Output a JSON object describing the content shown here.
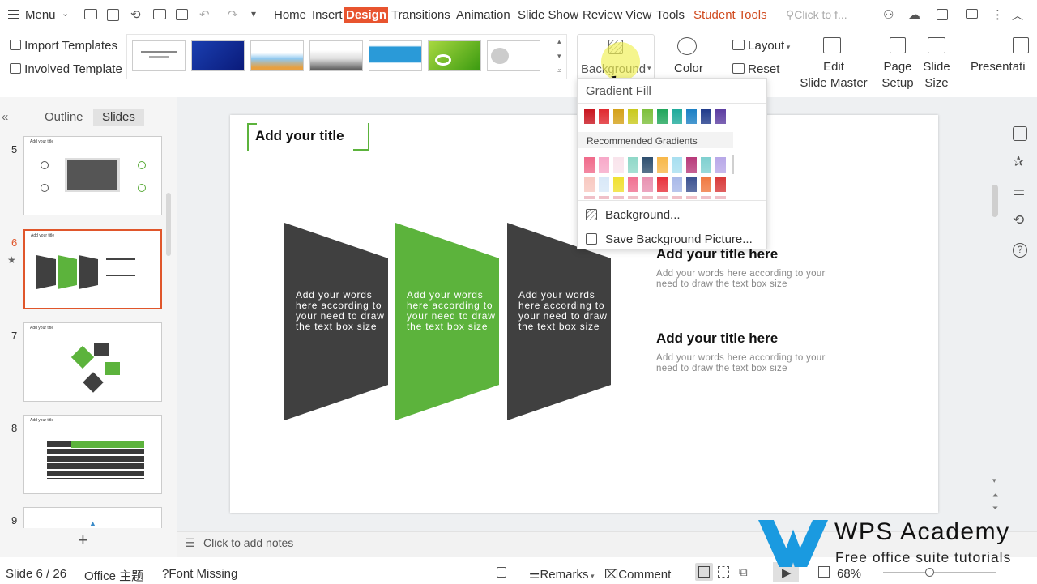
{
  "menubar": {
    "menu_label": "Menu",
    "tabs": [
      "Home",
      "Insert",
      "Design",
      "Transitions",
      "Animation",
      "Slide Show",
      "Review",
      "View",
      "Tools",
      "Student Tools"
    ],
    "search_placeholder": "Click to f..."
  },
  "ribbon": {
    "import_templates": "Import Templates",
    "involved_template": "Involved Template",
    "background": "Background",
    "color": "Color",
    "layout": "Layout",
    "reset": "Reset",
    "edit_slide_master_1": "Edit",
    "edit_slide_master_2": "Slide Master",
    "page_setup_1": "Page",
    "page_setup_2": "Setup",
    "slide_size_1": "Slide",
    "slide_size_2": "Size",
    "presentation": "Presentati"
  },
  "sidebar": {
    "tab_outline": "Outline",
    "tab_slides": "Slides",
    "slide_numbers": [
      "5",
      "6",
      "7",
      "8",
      "9"
    ],
    "thumb_title": "Add your title"
  },
  "slide": {
    "title": "Add your title",
    "block1": "Add your words here according to your need to draw the text box size",
    "block2": "Add your words here according to your need to draw the text box size",
    "block3": "Add your words here according to your need to draw the text box size",
    "item1_title": "Add your title here",
    "item1_text": "Add your words here according to your need to draw the text box size",
    "item2_title": "Add your title here",
    "item2_text": "Add your words here according to your need to draw the text box size"
  },
  "notes_placeholder": "Click to add notes",
  "dropdown": {
    "gradient_fill": "Gradient Fill",
    "recommended": "Recommended Gradients",
    "background_item": "Background...",
    "save_picture": "Save Background Picture...",
    "row1_colors": [
      "#c8141e",
      "#e0282e",
      "#d4a017",
      "#c9c91c",
      "#7cbf3a",
      "#1fa55a",
      "#1eaa9a",
      "#1b7fc4",
      "#1f3a8a",
      "#5b3ca0"
    ],
    "grad_row1": [
      "#f06a8a",
      "#f7a8c8",
      "#f9e4ec",
      "#8fd8c8",
      "#2f4f6f",
      "#f8b84a",
      "#a8dff0",
      "#b83a7a",
      "#7fd0d0",
      "#b8a8e8"
    ],
    "grad_row2": [
      "#f8c8c0",
      "#d8e8f8",
      "#f0e030",
      "#f07090",
      "#e890b0",
      "#e8303a",
      "#a8b8e8",
      "#3a5090",
      "#f07840",
      "#d83838"
    ]
  },
  "status": {
    "slide_of": "Slide 6 / 26",
    "theme": "Office 主题",
    "font_missing": "Font Missing",
    "remarks": "Remarks",
    "comment": "Comment",
    "zoom": "68%"
  },
  "watermark": {
    "brand": "WPS Academy",
    "tagline": "Free office suite tutorials"
  }
}
